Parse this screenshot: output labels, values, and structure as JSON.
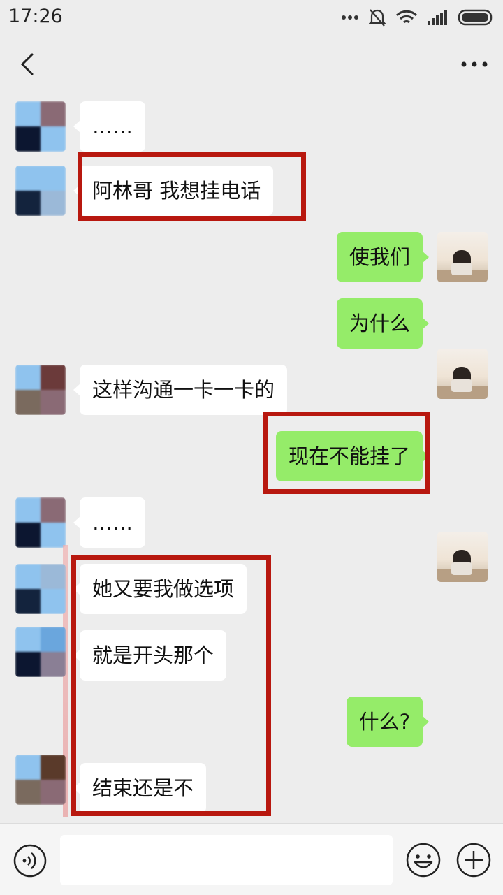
{
  "status_bar": {
    "time": "17:26"
  },
  "messages": [
    {
      "side": "in",
      "text": "……"
    },
    {
      "side": "in",
      "text": "阿林哥  我想挂电话"
    },
    {
      "side": "out",
      "text": "使我们"
    },
    {
      "side": "out",
      "text": "为什么"
    },
    {
      "side": "in",
      "text": "这样沟通一卡一卡的"
    },
    {
      "side": "out",
      "text": "现在不能挂了"
    },
    {
      "side": "in",
      "text": "……"
    },
    {
      "side": "in",
      "text": "她又要我做选项"
    },
    {
      "side": "in",
      "text": "就是开头那个"
    },
    {
      "side": "out",
      "text": "什么?"
    },
    {
      "side": "in",
      "text": "结束还是不"
    }
  ],
  "input": {
    "value": "",
    "placeholder": ""
  },
  "colors": {
    "bubble_out": "#95ec69",
    "bubble_in": "#ffffff",
    "highlight": "#b8180f",
    "background": "#ededed"
  },
  "icons": [
    "back-icon",
    "more-icon",
    "voice-icon",
    "emoji-icon",
    "plus-icon"
  ]
}
